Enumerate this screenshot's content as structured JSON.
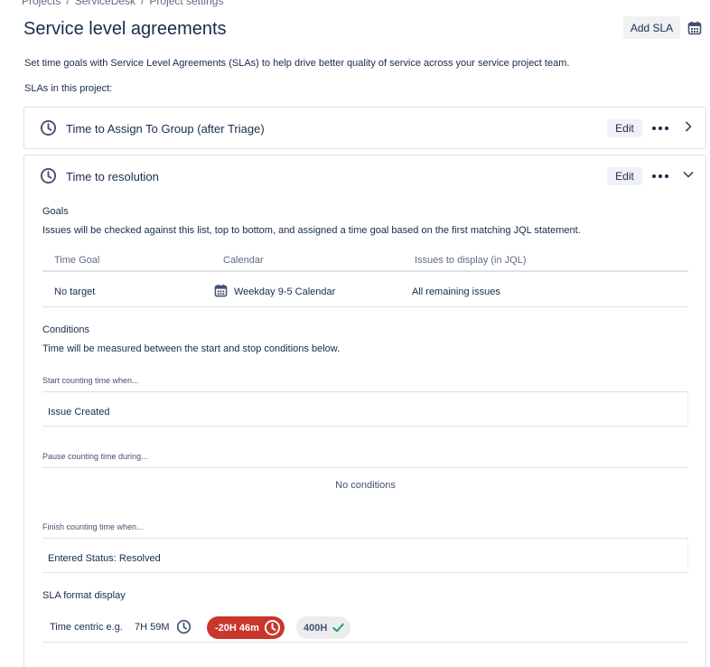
{
  "breadcrumb": {
    "items": [
      "Projects",
      "ServiceDesk",
      "Project settings"
    ],
    "separator": "/"
  },
  "header": {
    "title": "Service level agreements",
    "add_sla_label": "Add SLA",
    "calendar_icon": "calendar-icon"
  },
  "intro": "Set time goals with Service Level Agreements (SLAs) to help drive better quality of service across your service project team.",
  "slas_label": "SLAs in this project:",
  "slas": [
    {
      "title": "Time to Assign To Group (after Triage)",
      "edit_label": "Edit",
      "expanded": false
    },
    {
      "title": "Time to resolution",
      "edit_label": "Edit",
      "expanded": true
    }
  ],
  "goals": {
    "heading": "Goals",
    "description": "Issues will be checked against this list, top to bottom, and assigned a time goal based on the first matching JQL statement.",
    "columns": [
      "Time Goal",
      "Calendar",
      "Issues to display (in JQL)"
    ],
    "rows": [
      {
        "time_goal": "No target",
        "calendar": "Weekday 9-5 Calendar",
        "issues": "All remaining issues"
      }
    ]
  },
  "conditions": {
    "heading": "Conditions",
    "description": "Time will be measured between the start and stop conditions below.",
    "start_label": "Start counting time when...",
    "start_value": "Issue Created",
    "pause_label": "Pause counting time during...",
    "pause_value": "No conditions",
    "finish_label": "Finish counting time when...",
    "finish_value": "Entered Status: Resolved"
  },
  "sla_format": {
    "heading": "SLA format display",
    "label": "Time centric e.g.",
    "example_normal": "7H 59M",
    "example_breached": "-20H 46m",
    "example_met": "400H"
  },
  "colors": {
    "breached": "#c9372c",
    "met": "#22a06b",
    "text": "#172b4d",
    "muted": "#5e6c84"
  }
}
